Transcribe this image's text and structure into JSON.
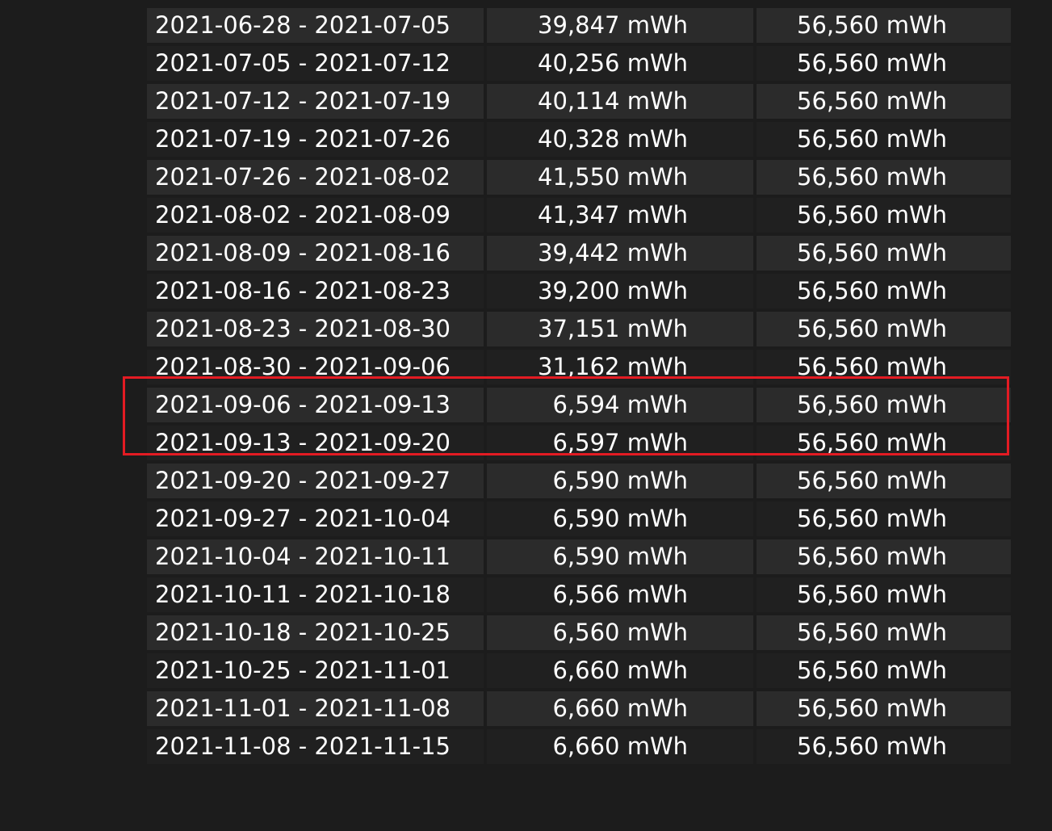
{
  "rows": [
    {
      "period": "2021-06-28 - 2021-07-05",
      "full_charge_capacity": "39,847 mWh",
      "design_capacity": "56,560 mWh"
    },
    {
      "period": "2021-07-05 - 2021-07-12",
      "full_charge_capacity": "40,256 mWh",
      "design_capacity": "56,560 mWh"
    },
    {
      "period": "2021-07-12 - 2021-07-19",
      "full_charge_capacity": "40,114 mWh",
      "design_capacity": "56,560 mWh"
    },
    {
      "period": "2021-07-19 - 2021-07-26",
      "full_charge_capacity": "40,328 mWh",
      "design_capacity": "56,560 mWh"
    },
    {
      "period": "2021-07-26 - 2021-08-02",
      "full_charge_capacity": "41,550 mWh",
      "design_capacity": "56,560 mWh"
    },
    {
      "period": "2021-08-02 - 2021-08-09",
      "full_charge_capacity": "41,347 mWh",
      "design_capacity": "56,560 mWh"
    },
    {
      "period": "2021-08-09 - 2021-08-16",
      "full_charge_capacity": "39,442 mWh",
      "design_capacity": "56,560 mWh"
    },
    {
      "period": "2021-08-16 - 2021-08-23",
      "full_charge_capacity": "39,200 mWh",
      "design_capacity": "56,560 mWh"
    },
    {
      "period": "2021-08-23 - 2021-08-30",
      "full_charge_capacity": "37,151 mWh",
      "design_capacity": "56,560 mWh"
    },
    {
      "period": "2021-08-30 - 2021-09-06",
      "full_charge_capacity": "31,162 mWh",
      "design_capacity": "56,560 mWh"
    },
    {
      "period": "2021-09-06 - 2021-09-13",
      "full_charge_capacity": "6,594 mWh",
      "design_capacity": "56,560 mWh"
    },
    {
      "period": "2021-09-13 - 2021-09-20",
      "full_charge_capacity": "6,597 mWh",
      "design_capacity": "56,560 mWh"
    },
    {
      "period": "2021-09-20 - 2021-09-27",
      "full_charge_capacity": "6,590 mWh",
      "design_capacity": "56,560 mWh"
    },
    {
      "period": "2021-09-27 - 2021-10-04",
      "full_charge_capacity": "6,590 mWh",
      "design_capacity": "56,560 mWh"
    },
    {
      "period": "2021-10-04 - 2021-10-11",
      "full_charge_capacity": "6,590 mWh",
      "design_capacity": "56,560 mWh"
    },
    {
      "period": "2021-10-11 - 2021-10-18",
      "full_charge_capacity": "6,566 mWh",
      "design_capacity": "56,560 mWh"
    },
    {
      "period": "2021-10-18 - 2021-10-25",
      "full_charge_capacity": "6,560 mWh",
      "design_capacity": "56,560 mWh"
    },
    {
      "period": "2021-10-25 - 2021-11-01",
      "full_charge_capacity": "6,660 mWh",
      "design_capacity": "56,560 mWh"
    },
    {
      "period": "2021-11-01 - 2021-11-08",
      "full_charge_capacity": "6,660 mWh",
      "design_capacity": "56,560 mWh"
    },
    {
      "period": "2021-11-08 - 2021-11-15",
      "full_charge_capacity": "6,660 mWh",
      "design_capacity": "56,560 mWh"
    }
  ],
  "colors": {
    "background": "#1c1c1c",
    "row_odd": "#2b2b2b",
    "row_even": "#202020",
    "text": "#ffffff",
    "highlight": "#e31b23"
  }
}
